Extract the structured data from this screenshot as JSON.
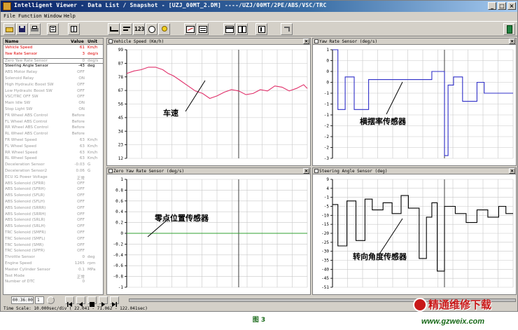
{
  "window": {
    "title": "Intelligent Viewer - Data List / Snapshot - [UZJ_00MT_2.DM] ----/UZJ/00MT/2PE/ABS/VSC/TRC",
    "buttons": [
      "_",
      "□",
      "×"
    ]
  },
  "menu": [
    "File",
    "Function",
    "Window",
    "Help"
  ],
  "toolbar": {
    "text_button": "123",
    "icons": [
      "open-folder",
      "save-disk",
      "print",
      "list-view",
      "table-view",
      "line-graph",
      "bar-graph",
      "numeric-view",
      "gauge-view",
      "led-view",
      "graph-config",
      "list-config",
      "split-horizontal",
      "split-vertical",
      "snapshot",
      "undo-arrow",
      "exit-door"
    ]
  },
  "params": {
    "headers": {
      "name": "Name",
      "value": "Value",
      "unit": "Unit"
    },
    "rows": [
      {
        "name": "Vehicle Speed",
        "value": "61",
        "unit": "Km/h",
        "style": "red"
      },
      {
        "name": "Yaw Rate Sensor",
        "value": "3",
        "unit": "deg/s",
        "style": "red"
      },
      {
        "name": "Zero Yaw Rate Sensor",
        "value": "0",
        "unit": "deg/s",
        "style": "sel"
      },
      {
        "name": "Steering Angle Sensor",
        "value": "-43",
        "unit": "deg",
        "style": "dark"
      },
      {
        "name": "ABS Motor Relay",
        "value": "OFF",
        "unit": ""
      },
      {
        "name": "Solenoid Relay",
        "value": "ON",
        "unit": ""
      },
      {
        "name": "High Hydraulic Boost SW",
        "value": "OFF",
        "unit": ""
      },
      {
        "name": "Low Hydraulic Boost SW",
        "value": "OFF",
        "unit": ""
      },
      {
        "name": "VSC/TRC OFF SW",
        "value": "OFF",
        "unit": ""
      },
      {
        "name": "Main Idle SW",
        "value": "ON",
        "unit": ""
      },
      {
        "name": "Stop Light SW",
        "value": "ON",
        "unit": ""
      },
      {
        "name": "FR Wheel ABS Control",
        "value": "Before",
        "unit": ""
      },
      {
        "name": "FL Wheel ABS Control",
        "value": "Before",
        "unit": ""
      },
      {
        "name": "RR Wheel ABS Control",
        "value": "Before",
        "unit": ""
      },
      {
        "name": "RL Wheel ABS Control",
        "value": "Before",
        "unit": ""
      },
      {
        "name": "FR Wheel Speed",
        "value": "63",
        "unit": "Km/h"
      },
      {
        "name": "FL Wheel Speed",
        "value": "63",
        "unit": "Km/h"
      },
      {
        "name": "RR Wheel Speed",
        "value": "63",
        "unit": "Km/h"
      },
      {
        "name": "RL Wheel Speed",
        "value": "63",
        "unit": "Km/h"
      },
      {
        "name": "Deceleration Sensor",
        "value": "-0.03",
        "unit": "G"
      },
      {
        "name": "Deceleration Sensor2",
        "value": "0.06",
        "unit": "G"
      },
      {
        "name": "ECU IG Power Voltage",
        "value": "正常",
        "unit": ""
      },
      {
        "name": "ABS Solenoid (SFRR)",
        "value": "OFF",
        "unit": ""
      },
      {
        "name": "ABS Solenoid (SFRH)",
        "value": "OFF",
        "unit": ""
      },
      {
        "name": "ABS Solenoid (SFLR)",
        "value": "OFF",
        "unit": ""
      },
      {
        "name": "ABS Solenoid (SFLH)",
        "value": "OFF",
        "unit": ""
      },
      {
        "name": "ABS Solenoid (SRRR)",
        "value": "OFF",
        "unit": ""
      },
      {
        "name": "ABS Solenoid (SRRH)",
        "value": "OFF",
        "unit": ""
      },
      {
        "name": "ABS Solenoid (SRLR)",
        "value": "OFF",
        "unit": ""
      },
      {
        "name": "ABS Solenoid (SRLH)",
        "value": "OFF",
        "unit": ""
      },
      {
        "name": "TRC Solenoid (SMFR)",
        "value": "OFF",
        "unit": ""
      },
      {
        "name": "TRC Solenoid (SMFL)",
        "value": "OFF",
        "unit": ""
      },
      {
        "name": "TRC Solenoid (SMR)",
        "value": "OFF",
        "unit": ""
      },
      {
        "name": "TRC Solenoid (SPFR)",
        "value": "OFF",
        "unit": ""
      },
      {
        "name": "Throttle Sensor",
        "value": "0",
        "unit": "deg"
      },
      {
        "name": "Engine Speed",
        "value": "1265",
        "unit": "rpm"
      },
      {
        "name": "Master Cylinder Sensor",
        "value": "0.1",
        "unit": "MPa"
      },
      {
        "name": "Test Mode",
        "value": "正常",
        "unit": ""
      },
      {
        "name": "Number of DTC",
        "value": "0",
        "unit": ""
      }
    ]
  },
  "chart_data": [
    {
      "type": "line",
      "title": "Vehicle Speed (Km/h)",
      "annotation": "车速",
      "ylim": [
        12,
        99
      ],
      "yticks": [
        99,
        87,
        78,
        67,
        56,
        45,
        34,
        23,
        12
      ],
      "grid": true,
      "color": "#e0306a",
      "x": [
        0,
        4,
        8,
        12,
        16,
        20,
        23,
        26,
        30,
        34,
        38,
        42,
        46,
        50,
        54,
        58,
        62,
        66,
        70,
        74,
        78,
        82,
        86,
        90,
        94,
        98,
        100
      ],
      "values": [
        80,
        82,
        83,
        85,
        85,
        83,
        80,
        78,
        74,
        70,
        66,
        64,
        60,
        62,
        65,
        67,
        66,
        63,
        64,
        67,
        66,
        70,
        69,
        66,
        68,
        71,
        68
      ]
    },
    {
      "type": "line",
      "title": "Yaw Rate Sensor (deg/s)",
      "annotation": "横摆率传感器",
      "ylim": [
        -3,
        1
      ],
      "yticks": [
        1,
        0,
        0,
        0,
        -1,
        -1,
        -1,
        -2,
        -2,
        -2,
        -3
      ],
      "grid": true,
      "color": "#3030c8",
      "x": [
        0,
        3,
        3,
        7,
        7,
        12,
        12,
        20,
        20,
        55,
        55,
        62,
        62,
        64,
        64,
        67,
        67,
        72,
        72,
        80,
        80,
        84,
        84,
        100
      ],
      "values": [
        1.0,
        1.0,
        -1.2,
        -1.2,
        0.0,
        0.0,
        -1.2,
        -1.2,
        -0.1,
        -0.1,
        0.2,
        0.2,
        -2.9,
        -2.9,
        -0.3,
        -0.3,
        0.0,
        0.0,
        -0.9,
        -0.9,
        -0.2,
        -0.2,
        -0.6,
        -0.6
      ]
    },
    {
      "type": "line",
      "title": "Zero Yaw Rate Sensor (deg/s)",
      "annotation": "零点位置传感器",
      "ylim": [
        -1,
        1
      ],
      "yticks": [
        1,
        0.8,
        0.6,
        0.4,
        0.2,
        0,
        -0.2,
        -0.4,
        -0.6,
        -0.8,
        -1
      ],
      "grid": true,
      "color": "#30a030",
      "x": [
        0,
        100
      ],
      "values": [
        0,
        0
      ]
    },
    {
      "type": "line",
      "title": "Steering Angle Sensor (deg)",
      "annotation": "转向角度传感器",
      "ylim": [
        -51,
        9
      ],
      "yticks": [
        9,
        4,
        -1,
        -5,
        -10,
        -15,
        -20,
        -25,
        -30,
        -35,
        -40,
        -45,
        -51
      ],
      "grid": true,
      "color": "#000000",
      "x": [
        0,
        3,
        3,
        8,
        8,
        13,
        13,
        18,
        18,
        22,
        22,
        28,
        28,
        33,
        33,
        38,
        38,
        42,
        42,
        48,
        48,
        52,
        52,
        55,
        55,
        58,
        58,
        62,
        62,
        68,
        68,
        74,
        74,
        80,
        80,
        86,
        86,
        92,
        92,
        96,
        96,
        100
      ],
      "values": [
        -5,
        -5,
        -28,
        -28,
        -3,
        -3,
        -25,
        -25,
        -2,
        -2,
        -8,
        -8,
        -4,
        -4,
        -10,
        -10,
        0,
        0,
        -7,
        -7,
        -35,
        -35,
        -12,
        -12,
        -4,
        -4,
        -42,
        -42,
        -6,
        -6,
        -10,
        -10,
        -15,
        -15,
        -8,
        -8,
        -12,
        -12,
        -6,
        -6,
        -10,
        -10
      ]
    }
  ],
  "playback": {
    "time": "00:36:00",
    "step": "1"
  },
  "status": {
    "time_scale": "Time Scale:  10.000sec/div  ( 22.041 -  71.062 - 122.041sec)"
  },
  "caption": "图 3",
  "watermark": {
    "text": "精通维修下载",
    "url": "www.gzweix.com"
  }
}
